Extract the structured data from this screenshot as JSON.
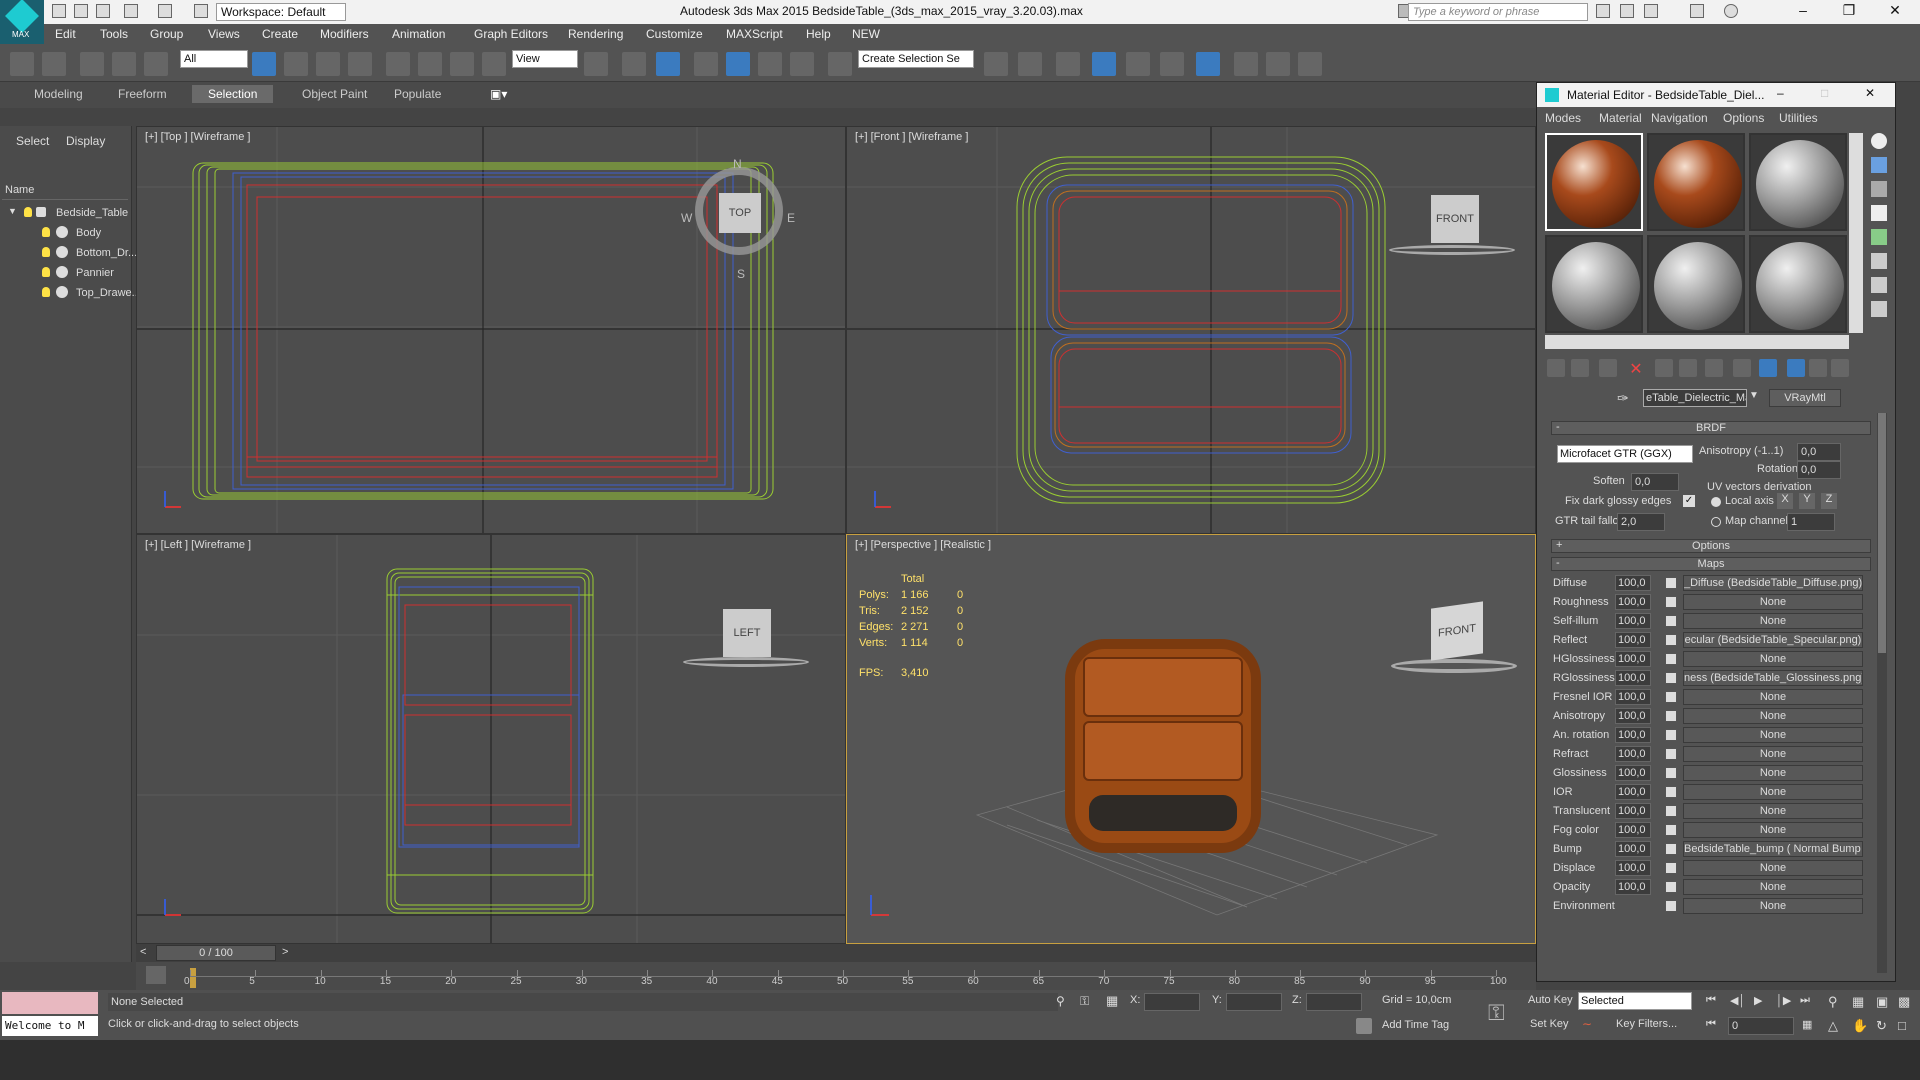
{
  "app": {
    "title": "Autodesk 3ds Max  2015     BedsideTable_(3ds_max_2015_vray_3.20.03).max",
    "workspace": "Workspace: Default",
    "search_placeholder": "Type a keyword or phrase",
    "logo_text": "MAX"
  },
  "menu": [
    "Edit",
    "Tools",
    "Group",
    "Views",
    "Create",
    "Modifiers",
    "Animation",
    "Graph Editors",
    "Rendering",
    "Customize",
    "MAXScript",
    "Help",
    "NEW"
  ],
  "toolbar": {
    "filter_value": "All",
    "refcoord_value": "View",
    "selection_set_placeholder": "Create Selection Se"
  },
  "ribbon": {
    "tabs": [
      "Modeling",
      "Freeform",
      "Selection",
      "Object Paint",
      "Populate"
    ],
    "active": "Selection"
  },
  "explorer": {
    "tabs": [
      "Select",
      "Display"
    ],
    "name_header": "Name",
    "root": "Bedside_Table",
    "children": [
      "Body",
      "Bottom_Dr...",
      "Pannier",
      "Top_Drawe..."
    ]
  },
  "viewports": {
    "top": {
      "label": "[+] [Top ] [Wireframe ]",
      "cube": "TOP",
      "compass": [
        "N",
        "E",
        "S",
        "W"
      ]
    },
    "front": {
      "label": "[+] [Front ] [Wireframe ]",
      "cube": "FRONT"
    },
    "left": {
      "label": "[+] [Left ] [Wireframe ]",
      "cube": "LEFT"
    },
    "persp": {
      "label": "[+] [Perspective ] [Realistic ]",
      "cube": "FRONT",
      "stats": {
        "total_header": "Total",
        "rows": [
          {
            "k": "Polys:",
            "v": "1 166",
            "s": "0"
          },
          {
            "k": "Tris:",
            "v": "2 152",
            "s": "0"
          },
          {
            "k": "Edges:",
            "v": "2 271",
            "s": "0"
          },
          {
            "k": "Verts:",
            "v": "1 114",
            "s": "0"
          }
        ],
        "fps_label": "FPS:",
        "fps": "3,410"
      }
    }
  },
  "timeline": {
    "frame": "0 / 100",
    "ticks": [
      "0",
      "5",
      "10",
      "15",
      "20",
      "25",
      "30",
      "35",
      "40",
      "45",
      "50",
      "55",
      "60",
      "65",
      "70",
      "75",
      "80",
      "85",
      "90",
      "95",
      "100"
    ]
  },
  "status": {
    "welcome": "Welcome to M",
    "selected": "None Selected",
    "prompt": "Click or click-and-drag to select objects",
    "x_label": "X:",
    "y_label": "Y:",
    "z_label": "Z:",
    "grid": "Grid = 10,0cm",
    "add_time_tag": "Add Time Tag",
    "auto_key": "Auto Key",
    "set_key": "Set Key",
    "key_mode": "Selected",
    "key_filters": "Key Filters...",
    "frame_field": "0"
  },
  "material_editor": {
    "title": "Material Editor - BedsideTable_Diel...",
    "menu": [
      "Modes",
      "Material",
      "Navigation",
      "Options",
      "Utilities"
    ],
    "material_name": "eTable_Dielectric_Material",
    "material_type": "VRayMtl",
    "brdf": {
      "header": "BRDF",
      "type": "Microfacet GTR (GGX)",
      "anisotropy_label": "Anisotropy (-1..1)",
      "anisotropy": "0,0",
      "rotation_label": "Rotation",
      "rotation": "0,0",
      "soften_label": "Soften",
      "soften": "0,0",
      "uv_label": "UV vectors derivation",
      "local_axis": "Local axis",
      "axes": [
        "X",
        "Y",
        "Z"
      ],
      "map_channel": "Map channel",
      "map_channel_value": "1",
      "fix_dark": "Fix dark glossy edges",
      "gtr_label": "GTR tail falloff",
      "gtr": "2,0"
    },
    "options_header": "Options",
    "maps_header": "Maps",
    "maps": [
      {
        "name": "Diffuse",
        "amount": "100,0",
        "map": "_Diffuse (BedsideTable_Diffuse.png)"
      },
      {
        "name": "Roughness",
        "amount": "100,0",
        "map": "None"
      },
      {
        "name": "Self-illum",
        "amount": "100,0",
        "map": "None"
      },
      {
        "name": "Reflect",
        "amount": "100,0",
        "map": "ecular (BedsideTable_Specular.png)"
      },
      {
        "name": "HGlossiness",
        "amount": "100,0",
        "map": "None"
      },
      {
        "name": "RGlossiness",
        "amount": "100,0",
        "map": "ness (BedsideTable_Glossiness.png)"
      },
      {
        "name": "Fresnel IOR",
        "amount": "100,0",
        "map": "None"
      },
      {
        "name": "Anisotropy",
        "amount": "100,0",
        "map": "None"
      },
      {
        "name": "An. rotation",
        "amount": "100,0",
        "map": "None"
      },
      {
        "name": "Refract",
        "amount": "100,0",
        "map": "None"
      },
      {
        "name": "Glossiness",
        "amount": "100,0",
        "map": "None"
      },
      {
        "name": "IOR",
        "amount": "100,0",
        "map": "None"
      },
      {
        "name": "Translucent",
        "amount": "100,0",
        "map": "None"
      },
      {
        "name": "Fog color",
        "amount": "100,0",
        "map": "None"
      },
      {
        "name": "Bump",
        "amount": "100,0",
        "map": "BedsideTable_bump  ( Normal Bump )"
      },
      {
        "name": "Displace",
        "amount": "100,0",
        "map": "None"
      },
      {
        "name": "Opacity",
        "amount": "100,0",
        "map": "None"
      },
      {
        "name": "Environment",
        "amount": "",
        "map": "None"
      }
    ]
  }
}
